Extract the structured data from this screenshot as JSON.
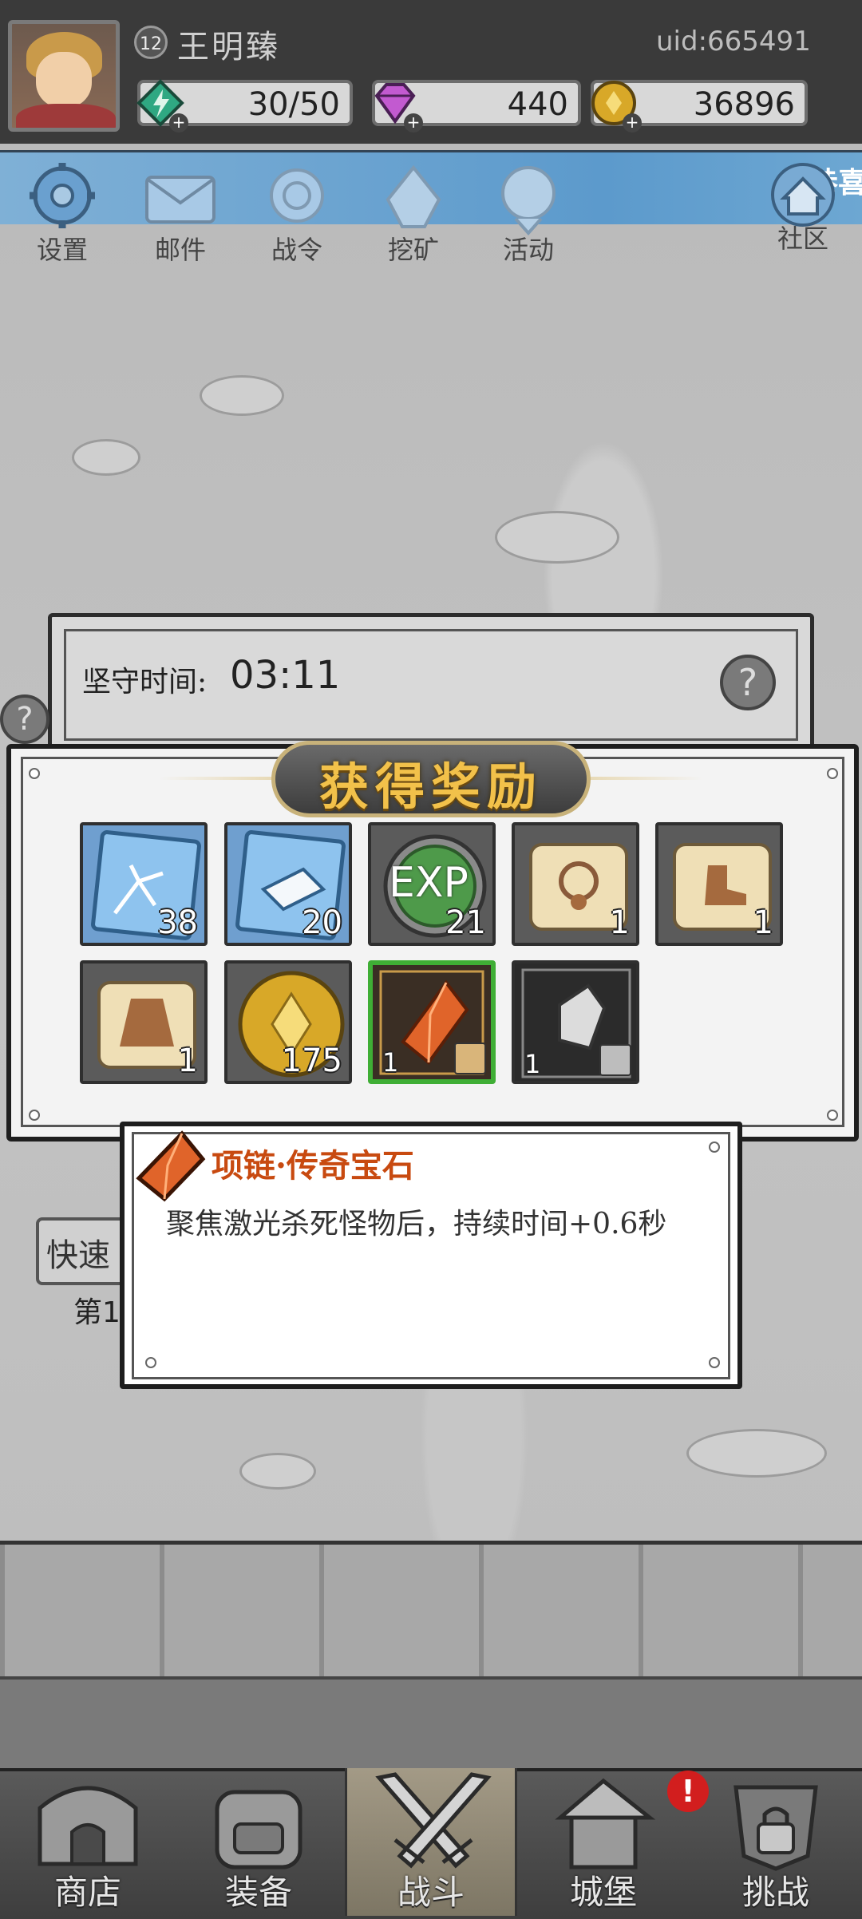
{
  "header": {
    "player_name": "王明臻",
    "level": "12",
    "uid": "uid:665491",
    "energy": "30/50",
    "gems": "440",
    "gold": "36896"
  },
  "banner": {
    "text": "恭喜"
  },
  "top_menu": [
    {
      "label": "设置",
      "icon": "gear-icon"
    },
    {
      "label": "邮件",
      "icon": "mail-icon"
    },
    {
      "label": "战令",
      "icon": "battle-pass-icon"
    },
    {
      "label": "挖矿",
      "icon": "mining-icon"
    },
    {
      "label": "活动",
      "icon": "event-icon"
    },
    {
      "label": "社区",
      "icon": "home-icon"
    }
  ],
  "stage": {
    "hold_label": "坚守时间:",
    "hold_time": "03:11",
    "help": "?"
  },
  "reward": {
    "title": "获得奖励",
    "items": [
      {
        "name": "ice-crystal",
        "count": "38"
      },
      {
        "name": "ice-stone",
        "count": "20"
      },
      {
        "name": "exp",
        "count": "21",
        "icon_text": "EXP"
      },
      {
        "name": "necklace-scroll",
        "count": "1"
      },
      {
        "name": "boots-scroll",
        "count": "1"
      },
      {
        "name": "armor-scroll",
        "count": "1"
      },
      {
        "name": "gold-coin",
        "count": "175"
      },
      {
        "name": "legendary-gem-necklace",
        "count": "1",
        "selected": true
      },
      {
        "name": "silver-stone",
        "count": "1"
      }
    ]
  },
  "tooltip": {
    "name": "项链·传奇宝石",
    "description": "聚焦激光杀死怪物后，持续时间+0.6秒"
  },
  "behind": {
    "quick_label": "快速",
    "chapter_label": "第1"
  },
  "nav": [
    {
      "label": "商店",
      "icon": "shop-icon"
    },
    {
      "label": "装备",
      "icon": "backpack-icon"
    },
    {
      "label": "战斗",
      "icon": "crossed-swords-icon",
      "active": true
    },
    {
      "label": "城堡",
      "icon": "castle-icon"
    },
    {
      "label": "挑战",
      "icon": "locked-challenge-icon"
    }
  ],
  "alert": "!",
  "colors": {
    "accent_gold": "#f2c14a",
    "selected_green": "#3fae35",
    "tooltip_name": "#c84a10",
    "banner_blue": "#5c9acc"
  }
}
